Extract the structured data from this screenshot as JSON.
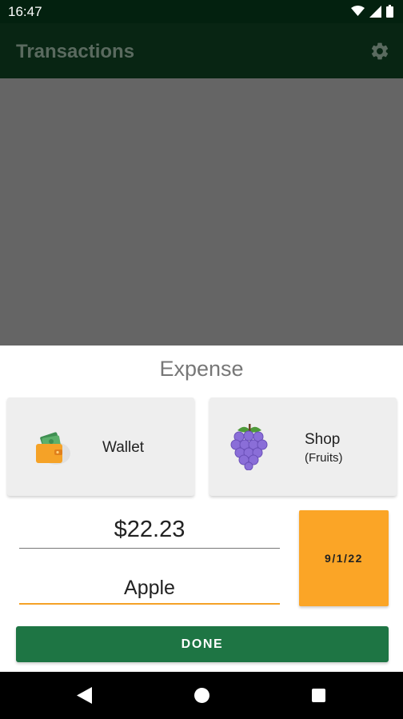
{
  "status_bar": {
    "time": "16:47",
    "icons": [
      "wifi-icon",
      "signal-icon",
      "battery-icon"
    ]
  },
  "app_bar": {
    "title": "Transactions",
    "settings_icon": "gear-icon"
  },
  "sheet": {
    "title": "Expense",
    "account": {
      "label": "Wallet",
      "icon": "wallet-icon"
    },
    "category": {
      "label": "Shop",
      "sublabel": "(Fruits)",
      "icon": "grape-icon"
    },
    "amount": "$22.23",
    "note": "Apple",
    "date": "9/1/22",
    "done_label": "DONE"
  },
  "colors": {
    "accent_orange": "#fba526",
    "primary_green": "#1e7544",
    "app_bar_dark": "#082513"
  },
  "nav_bar": {
    "icons": [
      "back-icon",
      "home-icon",
      "recents-icon"
    ]
  }
}
